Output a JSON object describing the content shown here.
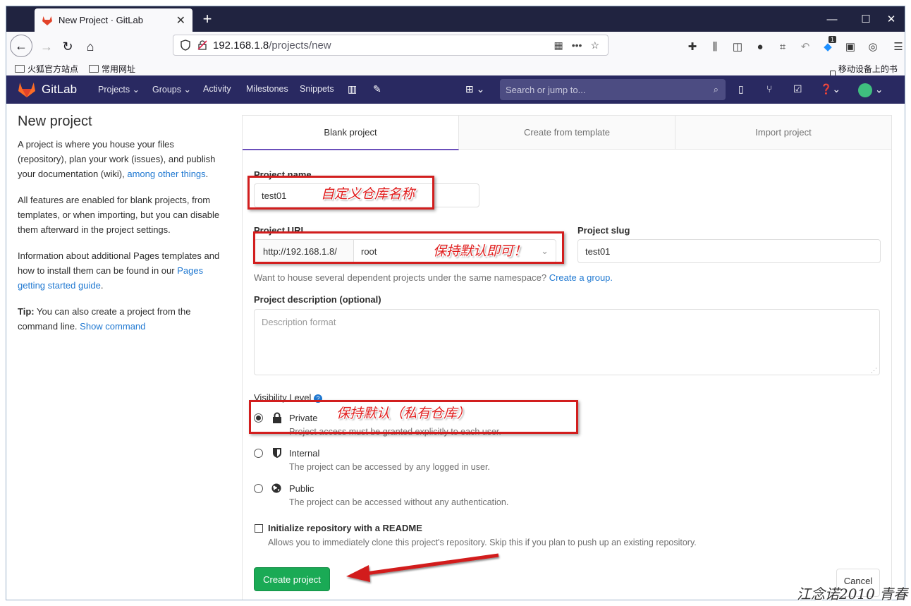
{
  "browser": {
    "tab_title": "New Project · GitLab",
    "url_host": "192.168.1.8",
    "url_path": "/projects/new",
    "bookmarks": [
      "火狐官方站点",
      "常用网址"
    ],
    "mobile_bookmarks": "移动设备上的书签",
    "notification_badge": "1"
  },
  "gitlab_nav": {
    "brand": "GitLab",
    "projects": "Projects",
    "groups": "Groups",
    "activity": "Activity",
    "milestones": "Milestones",
    "snippets": "Snippets",
    "search_placeholder": "Search or jump to..."
  },
  "sidebar": {
    "title": "New project",
    "p1_text": "A project is where you house your files (repository), plan your work (issues), and publish your documentation (wiki),",
    "p1_link": "among other things",
    "p1_end": ".",
    "p2": "All features are enabled for blank projects, from templates, or when importing, but you can disable them afterward in the project settings.",
    "p3_text": "Information about additional Pages templates and how to install them can be found in our",
    "p3_link": "Pages getting started guide",
    "p3_end": ".",
    "tip_label": "Tip:",
    "tip_text": "You can also create a project from the command line.",
    "tip_link": "Show command"
  },
  "tabs": [
    "Blank project",
    "Create from template",
    "Import project"
  ],
  "form": {
    "project_name_label": "Project name",
    "project_name_value": "test01",
    "project_url_label": "Project URL",
    "url_prefix": "http://192.168.1.8/",
    "namespace": "root",
    "slug_label": "Project slug",
    "slug_value": "test01",
    "help_text": "Want to house several dependent projects under the same namespace?",
    "help_link": "Create a group.",
    "description_label": "Project description (optional)",
    "description_placeholder": "Description format",
    "visibility_label": "Visibility Level",
    "visibility": [
      {
        "title": "Private",
        "desc": "Project access must be granted explicitly to each user.",
        "selected": true
      },
      {
        "title": "Internal",
        "desc": "The project can be accessed by any logged in user.",
        "selected": false
      },
      {
        "title": "Public",
        "desc": "The project can be accessed without any authentication.",
        "selected": false
      }
    ],
    "readme_label": "Initialize repository with a README",
    "readme_desc": "Allows you to immediately clone this project's repository. Skip this if you plan to push up an existing repository.",
    "create_button": "Create project",
    "cancel_button": "Cancel"
  },
  "annotations": {
    "name_note": "自定义仓库名称",
    "url_note": "保持默认即可！",
    "visibility_note": "保持默认（私有仓库）",
    "watermark": "江念诺2010 青春"
  },
  "colors": {
    "gitlab_header": "#292961",
    "create_green": "#1aaa55",
    "link_blue": "#1f78d1",
    "annotation_red": "#d21e1e"
  }
}
